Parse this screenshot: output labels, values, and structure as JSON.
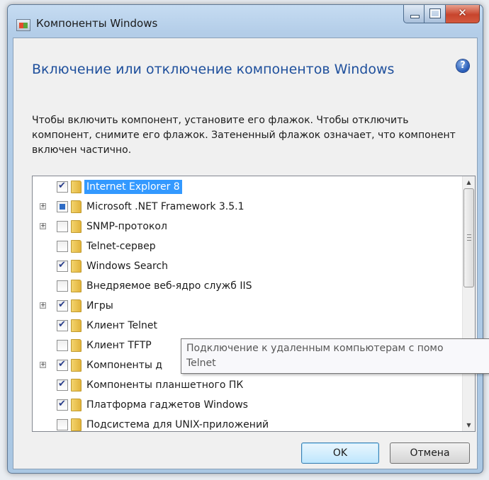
{
  "window": {
    "title": "Компоненты Windows"
  },
  "heading": "Включение или отключение компонентов Windows",
  "description": "Чтобы включить компонент, установите его флажок. Чтобы отключить компонент, снимите его флажок. Затененный флажок означает, что компонент включен частично.",
  "features": [
    {
      "label": "Internet Explorer 8",
      "state": "checked",
      "expandable": false,
      "selected": true
    },
    {
      "label": "Microsoft .NET Framework 3.5.1",
      "state": "partial",
      "expandable": true,
      "selected": false
    },
    {
      "label": "SNMP-протокол",
      "state": "unchecked",
      "expandable": true,
      "selected": false
    },
    {
      "label": "Telnet-сервер",
      "state": "unchecked",
      "expandable": false,
      "selected": false
    },
    {
      "label": "Windows Search",
      "state": "checked",
      "expandable": false,
      "selected": false
    },
    {
      "label": "Внедряемое веб-ядро служб IIS",
      "state": "unchecked",
      "expandable": false,
      "selected": false
    },
    {
      "label": "Игры",
      "state": "checked",
      "expandable": true,
      "selected": false
    },
    {
      "label": "Клиент Telnet",
      "state": "checked",
      "expandable": false,
      "selected": false
    },
    {
      "label": "Клиент TFTP",
      "state": "unchecked",
      "expandable": false,
      "selected": false
    },
    {
      "label": "Компоненты д",
      "state": "checked",
      "expandable": true,
      "selected": false
    },
    {
      "label": "Компоненты планшетного ПК",
      "state": "checked",
      "expandable": false,
      "selected": false
    },
    {
      "label": "Платформа гаджетов Windows",
      "state": "checked",
      "expandable": false,
      "selected": false
    },
    {
      "label": "Подсистема для UNIX-приложений",
      "state": "unchecked",
      "expandable": false,
      "selected": false
    }
  ],
  "tooltip": {
    "line1": "Подключение к удаленным компьютерам с помо",
    "line2": "Telnet"
  },
  "buttons": {
    "ok": "OK",
    "cancel": "Отмена"
  },
  "help_symbol": "?",
  "colors": {
    "heading": "#1e4f9c",
    "selection": "#3399ff",
    "close_button": "#c8442c"
  }
}
